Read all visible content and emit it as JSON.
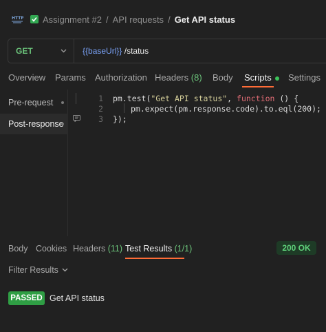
{
  "breadcrumb": {
    "icon": "http-request-icon",
    "collection": "Assignment #2",
    "folder": "API requests",
    "request": "Get API status",
    "separator": "/"
  },
  "request": {
    "method": "GET",
    "url_variable": "{{baseUrl}}",
    "url_path": "/status",
    "method_color": "#6cc47b"
  },
  "tabs": {
    "overview": "Overview",
    "params": "Params",
    "authorization": "Authorization",
    "headers": "Headers",
    "headers_count": "(8)",
    "body": "Body",
    "scripts": "Scripts",
    "settings": "Settings",
    "active": "Scripts"
  },
  "scripts_panel": {
    "pre_request": "Pre-request",
    "post_response": "Post-response",
    "active": "Post-response"
  },
  "code": {
    "line_numbers": [
      "1",
      "2",
      "3"
    ],
    "line1": {
      "a": "pm.test(",
      "str": "\"Get API status\"",
      "b": ", ",
      "kw": "function",
      "c": " () {"
    },
    "line2": "pm.expect(pm.response.code).to.eql(200);",
    "line3": "});"
  },
  "response": {
    "tabs": {
      "body": "Body",
      "cookies": "Cookies",
      "headers": "Headers",
      "headers_count": "(11)",
      "test_results": "Test Results",
      "test_results_count": "(1/1)",
      "active": "Test Results"
    },
    "status": "200 OK",
    "filter_label": "Filter Results",
    "results": [
      {
        "status": "PASSED",
        "name": "Get API status"
      }
    ]
  },
  "colors": {
    "accent": "#ff6c37",
    "success": "#2f9e44",
    "background": "#212121"
  }
}
